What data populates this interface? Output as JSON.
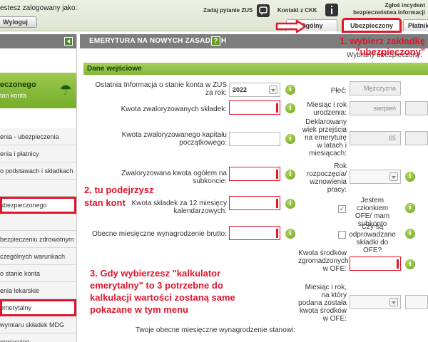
{
  "topbar": {
    "logged_in_label": "estesz zalogowany jako:",
    "logout_label": "Wyloguj",
    "ask_zus_label": "Zadaj pytanie ZUS",
    "ckk_label": "Kontakt z CKK",
    "report_line1": "Zgłoś incydent",
    "report_line2": "bezpieczeństwa informacji",
    "tabs": [
      {
        "label": "Ogólny",
        "active": false
      },
      {
        "label": "Ubezpieczony",
        "active": true
      },
      {
        "label": "Płatnik",
        "active": false
      }
    ]
  },
  "sidebar": {
    "card_title": "eczonego",
    "card_subtitle": "tan konta",
    "items": [
      "enia - ubezpieczenia",
      "enia i płatnicy",
      " o podstawach i składkach",
      "",
      "ubezpieczonego",
      "",
      "bezpieczeniu zdrowotnym",
      "czególnych warunkach",
      " o stanie konta",
      "enia lekarskie",
      "emerytalny",
      "wymiaru składek MDG",
      "ormacyjne"
    ]
  },
  "main": {
    "title": "EMERYTURA NA NOWYCH ZASADACH",
    "help_mark": "?",
    "insured_label": "Wybrany ubezpieczony:",
    "section_title": "Dane wejściowe",
    "left_fields": [
      {
        "label": "Ostatnia Informacja o stanie konta w ZUS za rok:",
        "value": "2022"
      },
      {
        "label": "Kwota zwaloryzowanych składek:",
        "value": ""
      },
      {
        "label": "Kwota zwaloryzowanego kapitału początkowego:",
        "value": ""
      },
      {
        "label": "Zwaloryzowana kwota ogółem na subkoncie:",
        "value": ""
      },
      {
        "label": "Kwota składek za 12 miesięcy kalendarzowych:",
        "value": ""
      },
      {
        "label": "Obecne miesięczne wynagrodzenie brutto:",
        "value": ""
      }
    ],
    "right_fields": [
      {
        "label": "Płeć:",
        "value": "Mężczyzna"
      },
      {
        "label": "Miesiąc i rok urodzenia:",
        "value": "sierpień"
      },
      {
        "label": "Deklarowany wiek przejścia na emeryturę w latach i miesiącach:",
        "value": "65"
      },
      {
        "label": "Rok rozpoczęcia/ wznowienia pracy:",
        "value": ""
      },
      {
        "label": "Jestem członkiem OFE/ mam subkonto",
        "checked": true
      },
      {
        "label": "Czy są odprowadzane składki do OFE?",
        "checked": false
      },
      {
        "label": "Kwota środków zgromadzonych w OFE:",
        "value": ""
      },
      {
        "label": "Miesiąc i rok, na który podana została kwota środków w OFE:",
        "value": ""
      }
    ],
    "bottom_text": "Twoje obecne miesięczne wynagrodzenie stanowi:"
  },
  "annotations": {
    "step1": "1. wybierz zakładkę \"ubezpieczony\"",
    "step2_line1": "2. tu podejrzysz",
    "step2_line2": "stan kont",
    "step3_line1": "3. Gdy wybierzesz \"kalkulator",
    "step3_line2": "emerytalny\" to 3 potrzebne do",
    "step3_line3": "kalkulacji wartości zostaną same",
    "step3_line4": "pokazane w tym menu"
  },
  "colors": {
    "annotation_red": "#e1152b",
    "zus_green": "#82b636",
    "header_gray": "#7d7d7d"
  }
}
